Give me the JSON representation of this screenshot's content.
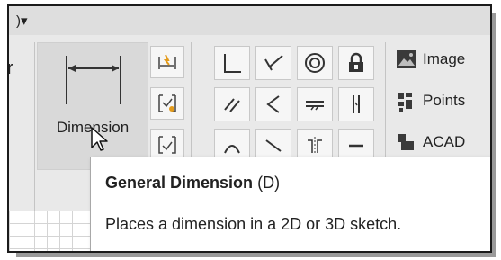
{
  "ribbon": {
    "dimension_button_label": "Dimension",
    "side_labels": {
      "image": "Image",
      "points": "Points",
      "acad": "ACAD"
    }
  },
  "tooltip": {
    "title": "General Dimension",
    "shortcut": "(D)",
    "description": "Places a dimension in a 2D or 3D sketch."
  },
  "icons": {
    "caret": "dropdown-caret-icon",
    "dimension": "dimension-icon",
    "cursor": "mouse-pointer-icon"
  }
}
